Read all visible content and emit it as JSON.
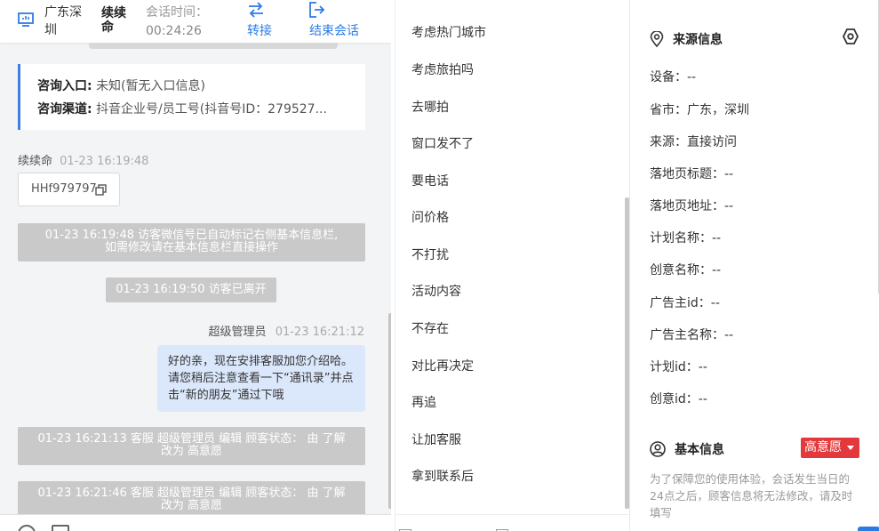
{
  "header": {
    "city": "广东深圳",
    "visitor_name": "续续命",
    "time_label": "会话时间：",
    "time_value": "00:24:26",
    "transfer_label": "转接",
    "end_label": "结束会话",
    "accent": "#2c7be5"
  },
  "entry_card": {
    "entry_label": "咨询入口:",
    "entry_value": "未知(暂无入口信息)",
    "channel_label": "咨询渠道:",
    "channel_value": "抖音企业号/员工号(抖音号ID：279527..."
  },
  "messages": {
    "visitor_meta_name": "续续命",
    "visitor_meta_time": "01-23 16:19:48",
    "wechat_id": "HHf979797",
    "sys1_line1": "01-23 16:19:48 访客微信号已自动标记右侧基本信息栏,",
    "sys1_line2": "如需修改请在基本信息栏直接操作",
    "sys2": "01-23 16:19:50 访客已离开",
    "agent_meta_name": "超级管理员",
    "agent_meta_time": "01-23 16:21:12",
    "agent_text": "好的亲，现在安排客服加您介绍哈。请您稍后注意查看一下“通讯录”并点击“新的朋友”通过下哦",
    "sys3_line1": "01-23 16:21:13 客服 超级管理员 编辑 顾客状态： 由 了解",
    "sys3_line2": "改为 高意愿",
    "sys4_line1": "01-23 16:21:46 客服 超级管理员 编辑 顾客状态： 由 了解",
    "sys4_line2": "改为 高意愿"
  },
  "quick_replies": [
    "考虑热门城市",
    "考虑旅拍吗",
    "去哪拍",
    "窗口发不了",
    "要电话",
    "问价格",
    "不打扰",
    "活动内容",
    "不存在",
    "对比再决定",
    "再追",
    "让加客服",
    "拿到联系后"
  ],
  "source_info": {
    "title": "来源信息",
    "rows": [
      "设备：--",
      "省市：广东，深圳",
      "来源：直接访问",
      "落地页标题：--",
      "落地页地址：--",
      "计划名称：--",
      "创意名称：--",
      "广告主id：--",
      "广告主名称：--",
      "计划id：--",
      "创意id：--"
    ]
  },
  "basic_info": {
    "title": "基本信息",
    "status_badge": "高意愿",
    "status_color": "#e4393c",
    "note": "为了保障您的使用体验，会话发生当日的24点之后，顾客信息将无法修改，请及时填写"
  },
  "icons": [
    "monitor-icon",
    "transfer-icon",
    "exit-icon",
    "copy-icon",
    "location-pin-icon",
    "settings-hexagon-icon",
    "user-circle-icon",
    "emoji-icon",
    "file-icon"
  ]
}
